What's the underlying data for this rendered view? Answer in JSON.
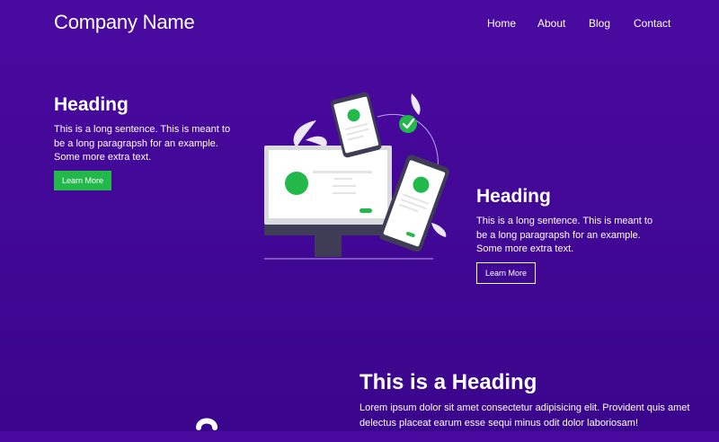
{
  "nav": {
    "brand": "Company Name",
    "links": [
      "Home",
      "About",
      "Blog",
      "Contact"
    ]
  },
  "hero_left": {
    "heading": "Heading",
    "text": "This is a long sentence. This is meant to be a long paragrapsh for an example. Some more extra text.",
    "button": "Learn More"
  },
  "hero_right": {
    "heading": "Heading",
    "text": "This is a long sentence. This is meant to be a long paragrapsh for an example. Some more extra text.",
    "button": "Learn More"
  },
  "section2": {
    "heading": "This is a Heading",
    "text": "Lorem ipsum dolor sit amet consectetur adipisicing elit. Provident quis amet delectus placeat earum esse sequi minus odit dolor laboriosam!"
  },
  "colors": {
    "background": "#4a0aa0",
    "accent_green": "#22b84a"
  },
  "icons": {
    "check": "check-icon",
    "leaf": "leaf-icon"
  }
}
